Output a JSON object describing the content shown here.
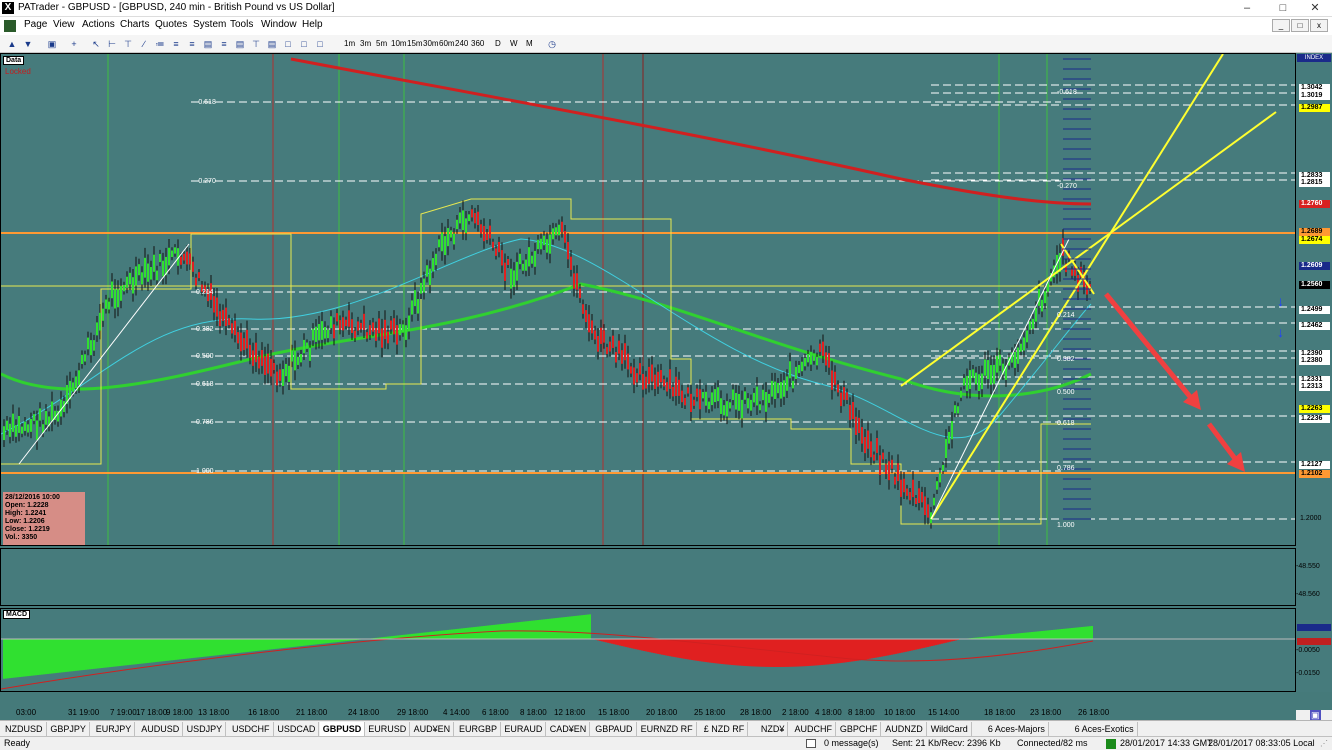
{
  "window": {
    "title": "PATrader - GBPUSD - [GBPUSD, 240 min - British Pound vs US Dollar]",
    "minimize": "–",
    "maximize": "□",
    "close": "✕"
  },
  "menu": [
    "Page",
    "View",
    "Actions",
    "Charts",
    "Quotes",
    "System",
    "Tools",
    "Window",
    "Help"
  ],
  "toolbar": {
    "timeframes": [
      "1m",
      "3m",
      "5m",
      "10m",
      "15m",
      "30m",
      "60m",
      "240",
      "360",
      "D",
      "W",
      "M"
    ]
  },
  "chart": {
    "data_label": "Data",
    "locked_label": "Locked",
    "index_label": "INDEX",
    "info": {
      "date": "28/12/2016 10:00",
      "open": "Open: 1.2228",
      "high": "High: 1.2241",
      "low": "Low: 1.2206",
      "close": "Close: 1.2219",
      "vol": "Vol.: 3350"
    },
    "fib_left": [
      "-0.618",
      "-0.270",
      "0.214",
      "0.382",
      "0.500",
      "0.618",
      "0.786",
      "1.000"
    ],
    "fib_right": [
      "-0.618",
      "-0.270",
      "0.214",
      "0.382",
      "0.500",
      "0.618",
      "0.786",
      "1.000"
    ],
    "price_labels": [
      {
        "text": "1.3042",
        "bg": "#ffffff",
        "fg": "#000000"
      },
      {
        "text": "1.3019",
        "bg": "#ffffff",
        "fg": "#000000"
      },
      {
        "text": "1.2987",
        "bg": "#ffff00",
        "fg": "#000000"
      },
      {
        "text": "1.2833",
        "bg": "#ffffff",
        "fg": "#000000"
      },
      {
        "text": "1.2815",
        "bg": "#ffffff",
        "fg": "#000000"
      },
      {
        "text": "1.2760",
        "bg": "#d82020",
        "fg": "#ffffff"
      },
      {
        "text": "1.2689",
        "bg": "#ff9933",
        "fg": "#000000"
      },
      {
        "text": "1.2674",
        "bg": "#ffff00",
        "fg": "#000000"
      },
      {
        "text": "1.2609",
        "bg": "#1a2a8a",
        "fg": "#ffffff"
      },
      {
        "text": "1.2560",
        "bg": "#000000",
        "fg": "#ffffff"
      },
      {
        "text": "1.2499",
        "bg": "#ffffff",
        "fg": "#000000"
      },
      {
        "text": "1.2462",
        "bg": "#ffffff",
        "fg": "#000000"
      },
      {
        "text": "1.2390",
        "bg": "#ffffff",
        "fg": "#000000"
      },
      {
        "text": "1.2380",
        "bg": "#ffffff",
        "fg": "#000000"
      },
      {
        "text": "1.2331",
        "bg": "#ffffff",
        "fg": "#000000"
      },
      {
        "text": "1.2313",
        "bg": "#ffffff",
        "fg": "#000000"
      },
      {
        "text": "1.2263",
        "bg": "#ffff00",
        "fg": "#000000"
      },
      {
        "text": "1.2236",
        "bg": "#ffffff",
        "fg": "#000000"
      },
      {
        "text": "1.2127",
        "bg": "#ffffff",
        "fg": "#000000"
      },
      {
        "text": "1.2102",
        "bg": "#ff9933",
        "fg": "#000000"
      },
      {
        "text": "1.2000",
        "bg": "none",
        "fg": "#000000"
      }
    ],
    "sub_labels": [
      "-48.550",
      "-48.560"
    ],
    "macd_label": "MACD",
    "macd_values": [
      "-0.0050",
      "-0.0150"
    ],
    "time_labels": [
      "03:00",
      "31 19:00",
      "7 19:00",
      "17 18:00",
      "9 18:00",
      "13 18:00",
      "16 18:00",
      "21 18:00",
      "24 18:00",
      "29 18:00",
      "4 14:00",
      "6 18:00",
      "8 18:00",
      "12 18:00",
      "15 18:00",
      "20 18:00",
      "25 18:00",
      "28 18:00",
      "2 18:00",
      "4 18:00",
      "8 18:00",
      "10 18:00",
      "15 14:00",
      "18 18:00",
      "23 18:00",
      "26 18:00"
    ]
  },
  "tabs": [
    "NZDUSD",
    "GBPJPY",
    "EURJPY",
    "AUDUSD",
    "USDJPY",
    "USDCHF",
    "USDCAD",
    "GBPUSD",
    "EURUSD",
    "AUD¥EN",
    "EURGBP",
    "EURAUD",
    "CAD¥EN",
    "GBPAUD",
    "EURNZD RF",
    "£ NZD RF",
    "NZD¥",
    "AUDCHF",
    "GBPCHF",
    "AUDNZD",
    "WildCard",
    "6 Aces-Majors",
    "6 Aces-Exotics"
  ],
  "active_tab": "GBPUSD",
  "status": {
    "ready": "Ready",
    "messages": "0 message(s)",
    "traffic": "Sent: 21 Kb/Recv: 2396 Kb",
    "connection": "Connected/82 ms",
    "gmt": "28/01/2017 14:33 GMT",
    "local": "28/01/2017 08:33:05 Local"
  }
}
